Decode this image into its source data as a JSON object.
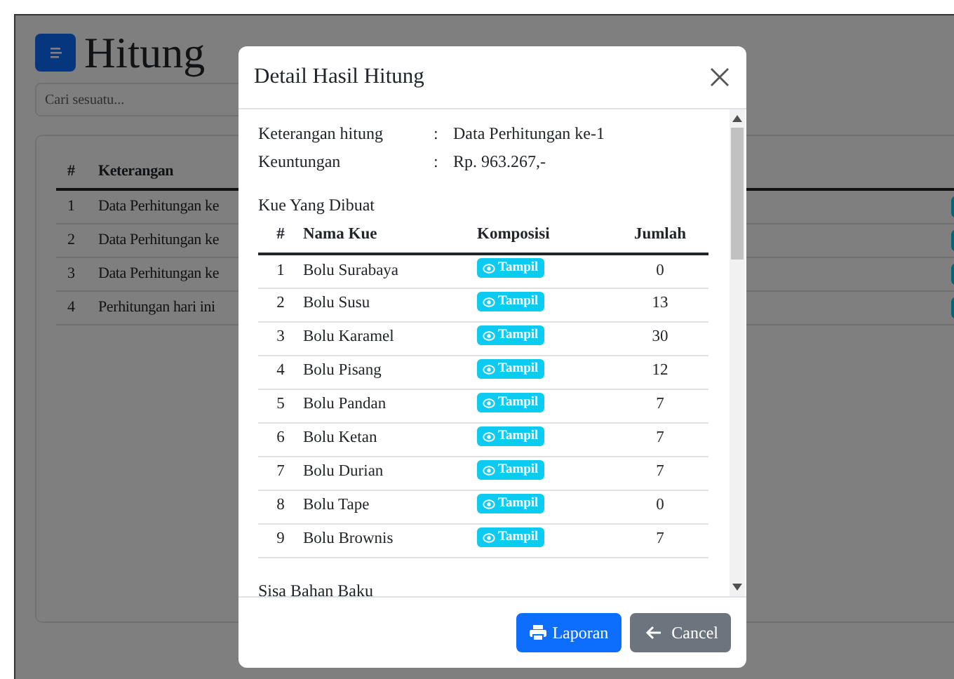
{
  "page": {
    "title": "Hitung",
    "search": {
      "placeholder": "Cari sesuatu..."
    },
    "table": {
      "columns": [
        "#",
        "Keterangan"
      ],
      "rows": [
        {
          "no": "1",
          "keterangan": "Data Perhitungan ke"
        },
        {
          "no": "2",
          "keterangan": "Data Perhitungan ke"
        },
        {
          "no": "3",
          "keterangan": "Data Perhitungan ke"
        },
        {
          "no": "4",
          "keterangan": "Perhitungan hari ini"
        }
      ]
    }
  },
  "modal": {
    "title": "Detail Hasil Hitung",
    "info": [
      {
        "label": "Keterangan hitung",
        "separator": ":",
        "value": "Data Perhitungan ke-1"
      },
      {
        "label": "Keuntungan",
        "separator": ":",
        "value": "Rp. 963.267,-"
      }
    ],
    "cakes": {
      "heading": "Kue Yang Dibuat",
      "columns": [
        "#",
        "Nama Kue",
        "Komposisi",
        "Jumlah"
      ],
      "rows": [
        {
          "no": "1",
          "name": "Bolu Surabaya",
          "action": "Tampil",
          "qty": "0"
        },
        {
          "no": "2",
          "name": "Bolu Susu",
          "action": "Tampil",
          "qty": "13"
        },
        {
          "no": "3",
          "name": "Bolu Karamel",
          "action": "Tampil",
          "qty": "30"
        },
        {
          "no": "4",
          "name": "Bolu Pisang",
          "action": "Tampil",
          "qty": "12"
        },
        {
          "no": "5",
          "name": "Bolu Pandan",
          "action": "Tampil",
          "qty": "7"
        },
        {
          "no": "6",
          "name": "Bolu Ketan",
          "action": "Tampil",
          "qty": "7"
        },
        {
          "no": "7",
          "name": "Bolu Durian",
          "action": "Tampil",
          "qty": "7"
        },
        {
          "no": "8",
          "name": "Bolu Tape",
          "action": "Tampil",
          "qty": "0"
        },
        {
          "no": "9",
          "name": "Bolu Brownis",
          "action": "Tampil",
          "qty": "7"
        }
      ]
    },
    "next_heading": "Sisa Bahan Baku",
    "buttons": [
      {
        "kind": "print",
        "label": "Laporan"
      },
      {
        "kind": "back",
        "label": "Cancel"
      }
    ]
  }
}
